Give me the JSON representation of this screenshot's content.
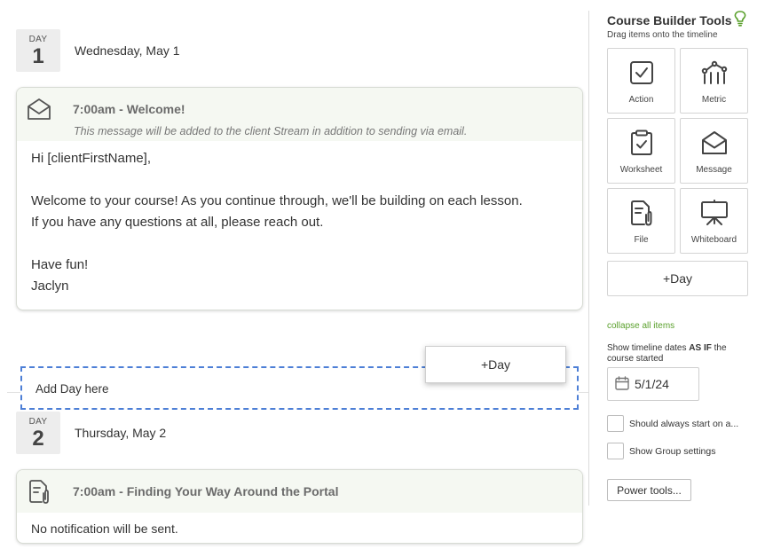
{
  "days": [
    {
      "label": "DAY",
      "number": "1",
      "date": "Wednesday, May 1"
    },
    {
      "label": "DAY",
      "number": "2",
      "date": "Thursday, May 2"
    }
  ],
  "cards": [
    {
      "icon": "envelope-icon",
      "title": "7:00am - Welcome!",
      "note": "This message will be added to the client Stream in addition to sending via email.",
      "body": "Hi [clientFirstName],\n\nWelcome to your course! As you continue through, we'll be building on each lesson.\nIf you have any questions at all, please reach out.\n\nHave fun!\nJaclyn"
    },
    {
      "icon": "file-clip-icon",
      "title": "7:00am - Finding Your Way Around the Portal",
      "body": "No notification will be sent."
    }
  ],
  "dropzone": {
    "text": "Add Day here"
  },
  "drag_ghost": {
    "label": "+Day"
  },
  "tools": {
    "title": "Course Builder Tools",
    "subtitle": "Drag items onto the timeline",
    "items": [
      {
        "label": "Action",
        "icon": "checkbox-icon"
      },
      {
        "label": "Metric",
        "icon": "metric-icon"
      },
      {
        "label": "Worksheet",
        "icon": "clipboard-icon"
      },
      {
        "label": "Message",
        "icon": "envelope-icon"
      },
      {
        "label": "File",
        "icon": "file-clip-icon"
      },
      {
        "label": "Whiteboard",
        "icon": "whiteboard-icon"
      }
    ],
    "add_day": "+Day",
    "collapse_all": "collapse all items",
    "dates_label_pre": "Show timeline dates ",
    "dates_label_bold": "AS IF",
    "dates_label_post": " the course started",
    "start_date": "5/1/24",
    "always_start_label": "Should always start on a...",
    "group_settings_label": "Show Group settings",
    "power_tools": "Power tools..."
  },
  "colors": {
    "accent_green": "#5aa02c",
    "dropzone_blue": "#4d7fd6",
    "card_header_bg": "#f5f8f2"
  }
}
